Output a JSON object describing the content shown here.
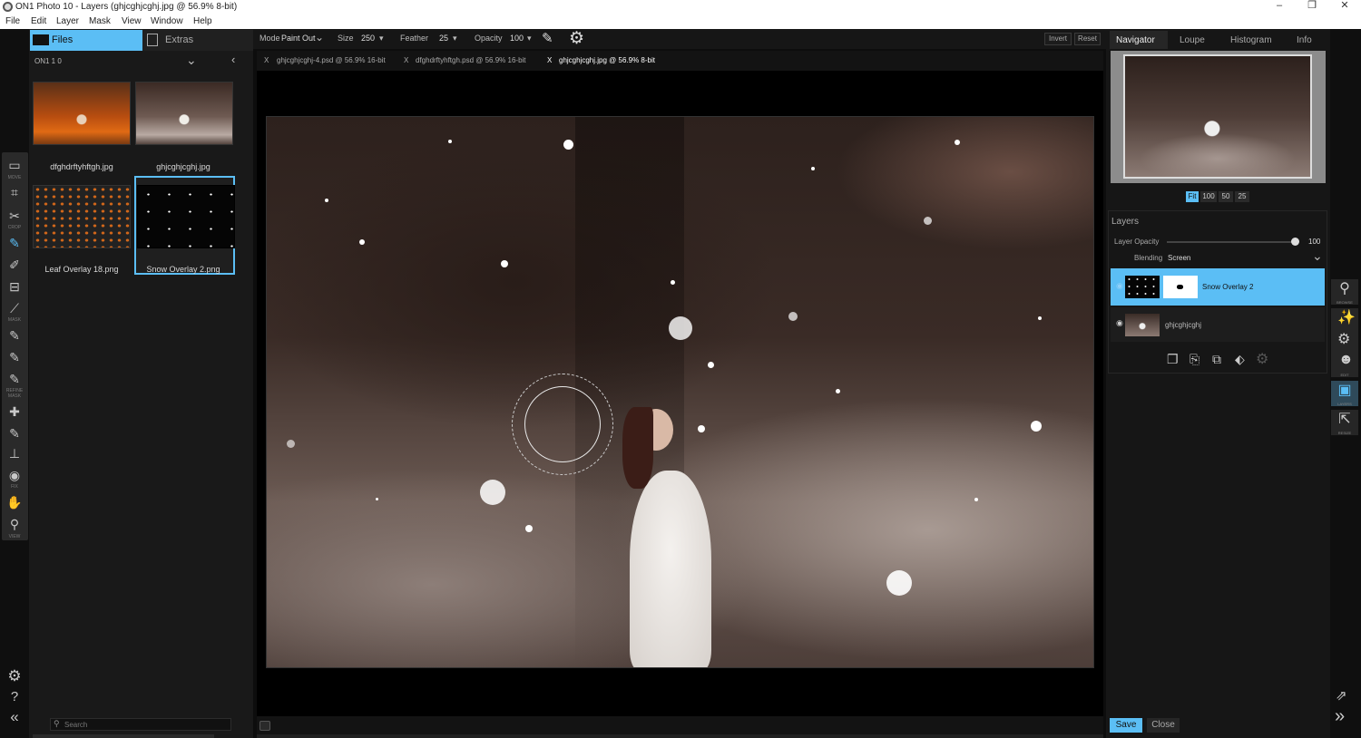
{
  "window": {
    "title": "ON1 Photo 10 - Layers (ghjcghjcghj.jpg @ 56.9% 8-bit)",
    "minimize": "–",
    "restore": "❐",
    "close": "✕"
  },
  "menu": [
    "File",
    "Edit",
    "Layer",
    "Mask",
    "View",
    "Window",
    "Help"
  ],
  "left_panel": {
    "tabs": {
      "files": "Files",
      "extras": "Extras"
    },
    "folder": "ON1 1 0",
    "thumbnails": [
      {
        "name": "dfghdrftyhftgh.jpg"
      },
      {
        "name": "ghjcghjcghj.jpg"
      },
      {
        "name": "Leaf Overlay 18.png"
      },
      {
        "name": "Snow Overlay 2.png"
      }
    ],
    "search_placeholder": "Search"
  },
  "tool_labels": [
    "MOVE",
    "CROP",
    "MASK",
    "REFINE MASK",
    "FIX",
    "VIEW"
  ],
  "options_bar": {
    "mode_label": "Mode",
    "mode_value": "Paint Out",
    "size_label": "Size",
    "size_value": "250",
    "feather_label": "Feather",
    "feather_value": "25",
    "opacity_label": "Opacity",
    "opacity_value": "100",
    "invert": "Invert",
    "reset": "Reset"
  },
  "document_tabs": [
    {
      "label": "ghjcghjcghj-4.psd @ 56.9% 16-bit",
      "close": "X"
    },
    {
      "label": "dfghdrftyhftgh.psd @ 56.9% 16-bit",
      "close": "X"
    },
    {
      "label": "ghjcghjcghj.jpg @ 56.9% 8-bit",
      "close": "X"
    }
  ],
  "right_panel": {
    "tabs": [
      "Navigator",
      "Loupe",
      "Histogram",
      "Info"
    ],
    "zoom_levels": [
      "Fit",
      "100",
      "50",
      "25"
    ],
    "layers_title": "Layers",
    "layer_opacity_label": "Layer Opacity",
    "layer_opacity_value": "100",
    "layer_opacity_fraction": 1.0,
    "blending_label": "Blending",
    "blending_value": "Screen",
    "layers": [
      {
        "name": "Snow Overlay 2",
        "selected": true
      },
      {
        "name": "ghjcghjcghj",
        "selected": false
      }
    ],
    "save": "Save",
    "close": "Close"
  },
  "right_tool_labels": [
    "BROWSE",
    "FX",
    "EDIT",
    "LAYERS",
    "RESIZE"
  ],
  "colors": {
    "accent": "#5bbef5",
    "panel": "#191919",
    "background": "#0d0d0d"
  }
}
